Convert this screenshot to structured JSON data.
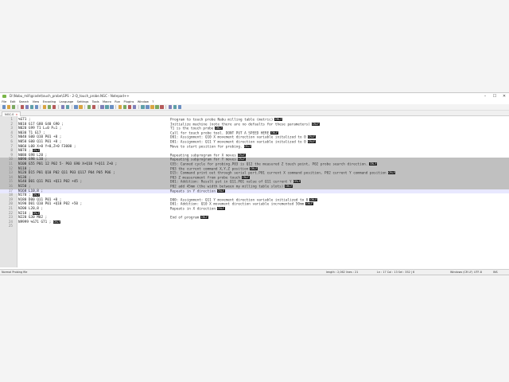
{
  "window": {
    "title": "D:\\Nabu_mill\\gcode\\touch_probe\\GPS - 2-Q_touch_probe.NGC - Notepad++",
    "controls": [
      "–",
      "☐",
      "✕"
    ]
  },
  "menu": [
    "File",
    "Edit",
    "Search",
    "View",
    "Encoding",
    "Language",
    "Settings",
    "Tools",
    "Macro",
    "Run",
    "Plugins",
    "Window",
    "?"
  ],
  "tab": {
    "label": "NGC.0",
    "close": "×"
  },
  "status": {
    "left": "Normal Probing file",
    "length": "length : 2,062    lines : 21",
    "pos": "Ln : 17    Col : 13    Sel : 352 | 6",
    "eol": "Windows (CR LF)",
    "enc": "UTF-8",
    "mode": "INS"
  },
  "lines": [
    {
      "n": "1",
      "code": "%G71 ;",
      "cmt": "Program to touch probe Nabu milling table (metric)",
      "eol": true,
      "hl": ""
    },
    {
      "n": "2",
      "code": "N010 G17 G80 G40 G90 ;",
      "cmt": "Initialize machine (note there are no defaults for these parameters)",
      "eol": true,
      "hl": ""
    },
    {
      "n": "3",
      "code": "N020 G99 T1 L=0 P=1 ;",
      "cmt": "T1 is the touch probe",
      "eol": true,
      "hl": ""
    },
    {
      "n": "4",
      "code": "N030 T1 G17 ;",
      "cmt": "Call for touch probe tool. DONT PUT A SPEED HERE",
      "eol": true,
      "hl": ""
    },
    {
      "n": "5",
      "code": "N040 G00 Q10 P01 +0 ;",
      "cmt": "D01: Assignment: Q10 X movement direction variable initalized to 0",
      "eol": true,
      "hl": ""
    },
    {
      "n": "6",
      "code": "N050 G00 Q11 P01 +0 ;",
      "cmt": "D01: Assignment: Q11 Y movement direction variable initalized to 0",
      "eol": true,
      "hl": ""
    },
    {
      "n": "7",
      "code": "N060 L00 X+0 Y+0,Z+0 F3000 ;",
      "cmt": "Move to start position for probing.",
      "eol": true,
      "hl": ""
    },
    {
      "n": "8",
      "code": "N070 ;",
      "cmt": "",
      "eol": true,
      "hl": ""
    },
    {
      "n": "9",
      "code": "N080 G98 L20 ;",
      "cmt": "Repeating subprogram for X moves",
      "eol": true,
      "hl": ""
    },
    {
      "n": "10",
      "code": "N090 G98 L10 ;",
      "cmt": "Repeating subprogram for Y moves",
      "eol": true,
      "hl": "sel"
    },
    {
      "n": "11",
      "code": "N100 G55 P01 12 P02 5- P03 G90 X+Q10 Y+Q11 Z+0 ;",
      "cmt": "G55: Canned cycle for probing.P03 is Q12 the measured Z touch point, P02 probe search direction.",
      "eol": true,
      "hl": "sel"
    },
    {
      "n": "12",
      "code": "N110 ;",
      "cmt": "P03 the current command X,Y,Z position",
      "eol": true,
      "hl": "sel"
    },
    {
      "n": "13",
      "code": "N120 D15 P01 Q10 P02 Q11 P03 Q117 P04 P05 P06 ;",
      "cmt": "D15: Command print out through serial port.P01 current X command position, P02 current Y command position",
      "eol": true,
      "hl": "sel"
    },
    {
      "n": "14",
      "code": "N130 ;",
      "cmt": "P03 Z measurement from probe touch",
      "eol": true,
      "hl": "sel"
    },
    {
      "n": "15",
      "code": "N140 D01 Q11 P01 +Q11 P02 +45 ;",
      "cmt": "D01: Addition: Result put in Q11.P01 value of Q11 current Y",
      "eol": true,
      "hl": "sel"
    },
    {
      "n": "16",
      "code": "N150 ;",
      "cmt": "P02 add 45mm (the width between my milling table slots)",
      "eol": true,
      "hl": "sel"
    },
    {
      "n": "17",
      "code": "N160 L10,8 ;",
      "cmt": "Repeats in Y direction",
      "eol": true,
      "hl": "cur"
    },
    {
      "n": "18",
      "code": "N170 ;",
      "cmt": "",
      "eol": true,
      "hl": ""
    },
    {
      "n": "19",
      "code": "N180 D00 Q11 P01 +0 ;",
      "cmt": "D00: Assignment: Q11 Y movement direction variable initialized to 0",
      "eol": true,
      "hl": ""
    },
    {
      "n": "20",
      "code": "N190 D01 Q10 P01 +Q10 P02 +50 ;",
      "cmt": "D01: Addition: Q10 X movement direction variable incremented 50mm",
      "eol": true,
      "hl": ""
    },
    {
      "n": "21",
      "code": "N200 L20,8 ;",
      "cmt": "Repeats in X direction",
      "eol": true,
      "hl": ""
    },
    {
      "n": "22",
      "code": "N210 ;",
      "cmt": "",
      "eol": true,
      "hl": ""
    },
    {
      "n": "23",
      "code": "N220 G30 M02 ;",
      "cmt": "End of program",
      "eol": true,
      "hl": ""
    },
    {
      "n": "24",
      "code": "N9999 %G71 G71 ;",
      "cmt": "",
      "eol": true,
      "hl": ""
    },
    {
      "n": "25",
      "code": "",
      "cmt": "",
      "eol": false,
      "hl": ""
    }
  ],
  "eol_marker": "CRLF"
}
